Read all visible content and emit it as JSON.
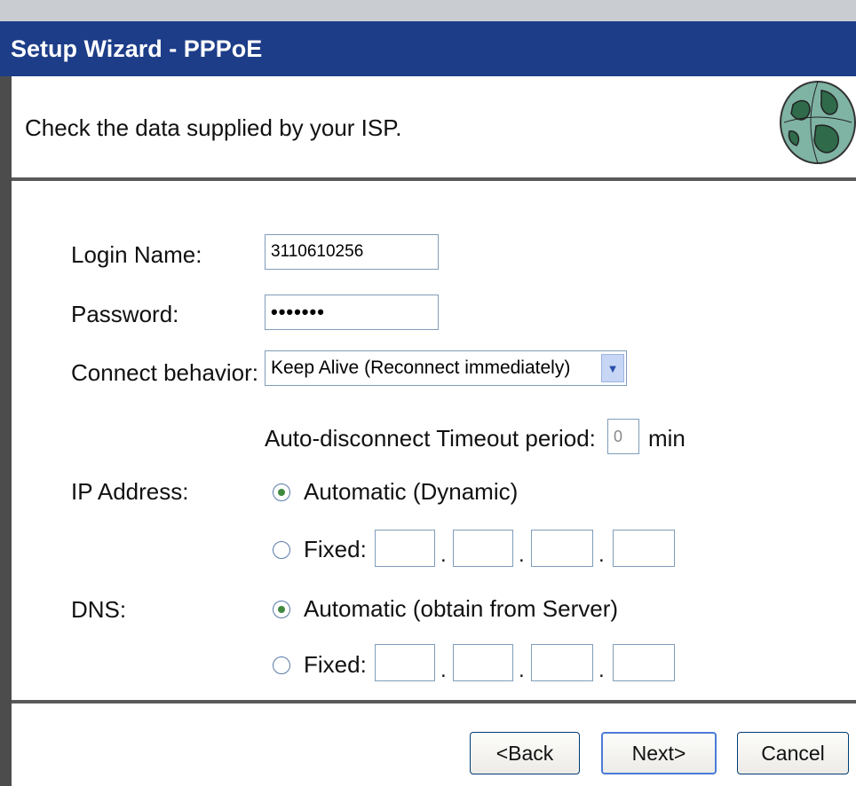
{
  "title": "Setup Wizard - PPPoE",
  "header": {
    "text": "Check the data supplied by your ISP."
  },
  "form": {
    "login_label": "Login Name:",
    "login_value": "3110610256",
    "password_label": "Password:",
    "password_value": "•••••••",
    "connect_label": "Connect behavior:",
    "connect_value": "Keep Alive (Reconnect immediately)",
    "timeout_label": "Auto-disconnect Timeout period:",
    "timeout_value": "0",
    "timeout_unit": "min",
    "ip_label": "IP Address:",
    "ip_auto_label": "Automatic (Dynamic)",
    "ip_fixed_label": "Fixed:",
    "dns_label": "DNS:",
    "dns_auto_label": "Automatic (obtain from Server)",
    "dns_fixed_label": "Fixed:",
    "ip_mode": "automatic",
    "dns_mode": "automatic"
  },
  "buttons": {
    "back": "<Back",
    "next": "Next>",
    "cancel": "Cancel"
  },
  "icons": {
    "globe": "globe-icon",
    "dropdown": "chevron-down-icon"
  },
  "colors": {
    "title_bg": "#1d3d88",
    "title_fg": "#ffffff",
    "accent": "#4a7bd8"
  }
}
